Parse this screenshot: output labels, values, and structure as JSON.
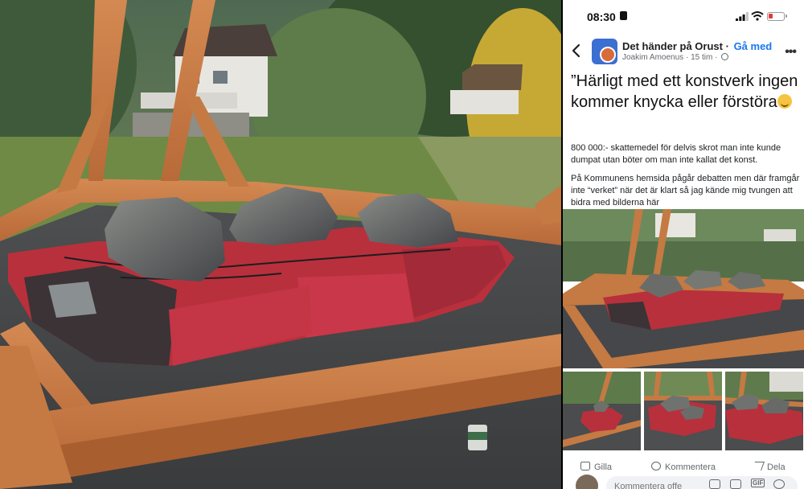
{
  "status_bar": {
    "time": "08:30"
  },
  "group": {
    "name": "Det händer på Orust",
    "join_label": "Gå med",
    "author": "Joakim Amoenus",
    "age": "15 tim"
  },
  "post": {
    "title": "”Härligt med ett konstverk ingen kommer knycka eller förstöra",
    "paragraph1": "800 000:- skattemedel för delvis skrot man inte kunde dumpat utan böter om man inte kallat det konst.",
    "paragraph2": "På Kommunens hemsida pågår debatten men där framgår inte “verket” när det är klart så jag kände mig tvungen att bidra med bilderna här"
  },
  "actions": {
    "like": "Gilla",
    "comment": "Kommentera",
    "share": "Dela"
  },
  "comment_bar": {
    "placeholder": "Kommentera offe",
    "gif_label": "GIF"
  },
  "icons": [
    "lock-icon",
    "signal-icon",
    "wifi-icon",
    "battery-icon",
    "back-icon",
    "globe-icon",
    "more-icon",
    "grinning-sweat-emoji-icon",
    "like-icon",
    "comment-icon",
    "share-icon",
    "camera-icon",
    "gif-icon",
    "sticker-icon"
  ],
  "colors": {
    "accent": "#1877f2",
    "battery_low": "#e23b3b",
    "car_red": "#b8303c",
    "wood": "#c77a45"
  }
}
